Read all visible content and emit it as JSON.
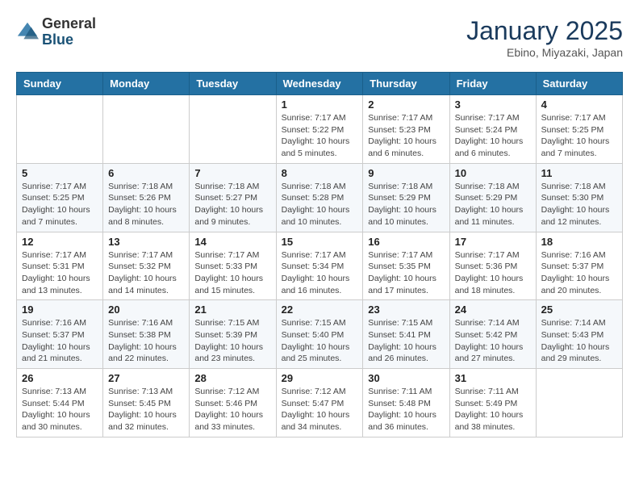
{
  "header": {
    "logo_general": "General",
    "logo_blue": "Blue",
    "month_year": "January 2025",
    "location": "Ebino, Miyazaki, Japan"
  },
  "weekdays": [
    "Sunday",
    "Monday",
    "Tuesday",
    "Wednesday",
    "Thursday",
    "Friday",
    "Saturday"
  ],
  "weeks": [
    [
      {
        "day": "",
        "info": ""
      },
      {
        "day": "",
        "info": ""
      },
      {
        "day": "",
        "info": ""
      },
      {
        "day": "1",
        "info": "Sunrise: 7:17 AM\nSunset: 5:22 PM\nDaylight: 10 hours\nand 5 minutes."
      },
      {
        "day": "2",
        "info": "Sunrise: 7:17 AM\nSunset: 5:23 PM\nDaylight: 10 hours\nand 6 minutes."
      },
      {
        "day": "3",
        "info": "Sunrise: 7:17 AM\nSunset: 5:24 PM\nDaylight: 10 hours\nand 6 minutes."
      },
      {
        "day": "4",
        "info": "Sunrise: 7:17 AM\nSunset: 5:25 PM\nDaylight: 10 hours\nand 7 minutes."
      }
    ],
    [
      {
        "day": "5",
        "info": "Sunrise: 7:17 AM\nSunset: 5:25 PM\nDaylight: 10 hours\nand 7 minutes."
      },
      {
        "day": "6",
        "info": "Sunrise: 7:18 AM\nSunset: 5:26 PM\nDaylight: 10 hours\nand 8 minutes."
      },
      {
        "day": "7",
        "info": "Sunrise: 7:18 AM\nSunset: 5:27 PM\nDaylight: 10 hours\nand 9 minutes."
      },
      {
        "day": "8",
        "info": "Sunrise: 7:18 AM\nSunset: 5:28 PM\nDaylight: 10 hours\nand 10 minutes."
      },
      {
        "day": "9",
        "info": "Sunrise: 7:18 AM\nSunset: 5:29 PM\nDaylight: 10 hours\nand 10 minutes."
      },
      {
        "day": "10",
        "info": "Sunrise: 7:18 AM\nSunset: 5:29 PM\nDaylight: 10 hours\nand 11 minutes."
      },
      {
        "day": "11",
        "info": "Sunrise: 7:18 AM\nSunset: 5:30 PM\nDaylight: 10 hours\nand 12 minutes."
      }
    ],
    [
      {
        "day": "12",
        "info": "Sunrise: 7:17 AM\nSunset: 5:31 PM\nDaylight: 10 hours\nand 13 minutes."
      },
      {
        "day": "13",
        "info": "Sunrise: 7:17 AM\nSunset: 5:32 PM\nDaylight: 10 hours\nand 14 minutes."
      },
      {
        "day": "14",
        "info": "Sunrise: 7:17 AM\nSunset: 5:33 PM\nDaylight: 10 hours\nand 15 minutes."
      },
      {
        "day": "15",
        "info": "Sunrise: 7:17 AM\nSunset: 5:34 PM\nDaylight: 10 hours\nand 16 minutes."
      },
      {
        "day": "16",
        "info": "Sunrise: 7:17 AM\nSunset: 5:35 PM\nDaylight: 10 hours\nand 17 minutes."
      },
      {
        "day": "17",
        "info": "Sunrise: 7:17 AM\nSunset: 5:36 PM\nDaylight: 10 hours\nand 18 minutes."
      },
      {
        "day": "18",
        "info": "Sunrise: 7:16 AM\nSunset: 5:37 PM\nDaylight: 10 hours\nand 20 minutes."
      }
    ],
    [
      {
        "day": "19",
        "info": "Sunrise: 7:16 AM\nSunset: 5:37 PM\nDaylight: 10 hours\nand 21 minutes."
      },
      {
        "day": "20",
        "info": "Sunrise: 7:16 AM\nSunset: 5:38 PM\nDaylight: 10 hours\nand 22 minutes."
      },
      {
        "day": "21",
        "info": "Sunrise: 7:15 AM\nSunset: 5:39 PM\nDaylight: 10 hours\nand 23 minutes."
      },
      {
        "day": "22",
        "info": "Sunrise: 7:15 AM\nSunset: 5:40 PM\nDaylight: 10 hours\nand 25 minutes."
      },
      {
        "day": "23",
        "info": "Sunrise: 7:15 AM\nSunset: 5:41 PM\nDaylight: 10 hours\nand 26 minutes."
      },
      {
        "day": "24",
        "info": "Sunrise: 7:14 AM\nSunset: 5:42 PM\nDaylight: 10 hours\nand 27 minutes."
      },
      {
        "day": "25",
        "info": "Sunrise: 7:14 AM\nSunset: 5:43 PM\nDaylight: 10 hours\nand 29 minutes."
      }
    ],
    [
      {
        "day": "26",
        "info": "Sunrise: 7:13 AM\nSunset: 5:44 PM\nDaylight: 10 hours\nand 30 minutes."
      },
      {
        "day": "27",
        "info": "Sunrise: 7:13 AM\nSunset: 5:45 PM\nDaylight: 10 hours\nand 32 minutes."
      },
      {
        "day": "28",
        "info": "Sunrise: 7:12 AM\nSunset: 5:46 PM\nDaylight: 10 hours\nand 33 minutes."
      },
      {
        "day": "29",
        "info": "Sunrise: 7:12 AM\nSunset: 5:47 PM\nDaylight: 10 hours\nand 34 minutes."
      },
      {
        "day": "30",
        "info": "Sunrise: 7:11 AM\nSunset: 5:48 PM\nDaylight: 10 hours\nand 36 minutes."
      },
      {
        "day": "31",
        "info": "Sunrise: 7:11 AM\nSunset: 5:49 PM\nDaylight: 10 hours\nand 38 minutes."
      },
      {
        "day": "",
        "info": ""
      }
    ]
  ]
}
